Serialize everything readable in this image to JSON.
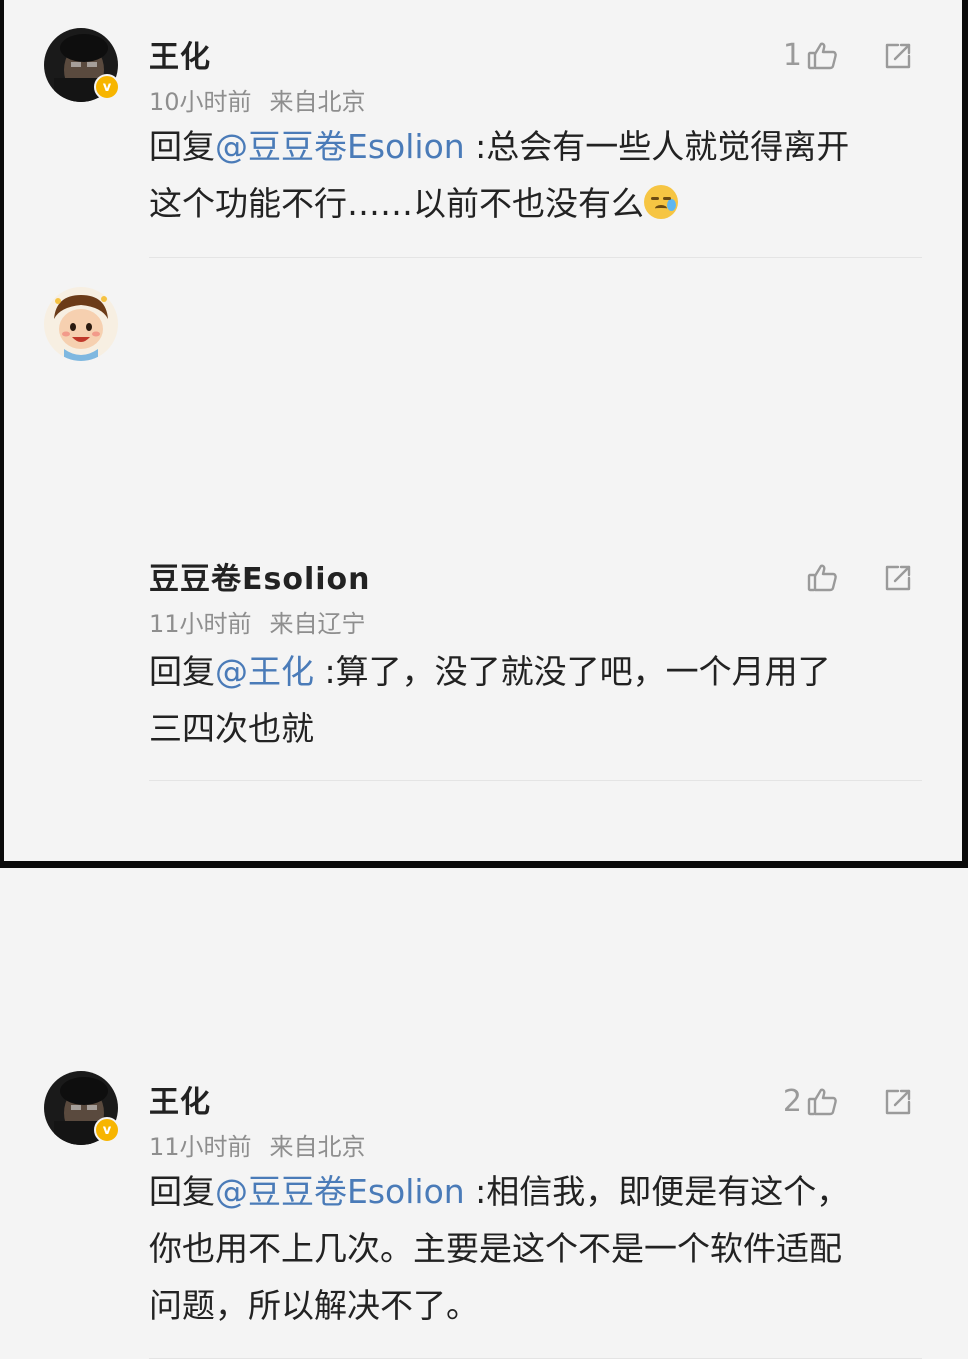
{
  "comments": [
    {
      "username": "王化",
      "time": "10小时前",
      "location": "来自北京",
      "like_count": "1",
      "verified": true,
      "reply_prefix": "回复",
      "mention": "@豆豆卷Esolion",
      "text_line1": " :总会有一些人就觉得离开",
      "text_line2": "这个功能不行……以前不也没有么",
      "emoji": "cold-sweat-emoji"
    },
    {
      "username": "豆豆卷Esolion",
      "time": "11小时前",
      "location": "来自辽宁",
      "like_count": "",
      "verified": false,
      "reply_prefix": "回复",
      "mention": "@王化",
      "text_line1": " :算了，没了就没了吧，一个月用了",
      "text_line2": "三四次也就"
    },
    {
      "username": "王化",
      "time": "11小时前",
      "location": "来自北京",
      "like_count": "2",
      "verified": true,
      "reply_prefix": "回复",
      "mention": "@豆豆卷Esolion",
      "text_line1": " :相信我，即便是有这个，",
      "text_line2": "你也用不上几次。主要是这个不是一个软件适配",
      "text_line3": "问题，所以解决不了。"
    }
  ],
  "icons": {
    "like": "thumbs-up-icon",
    "share": "share-icon",
    "verified": "verified-badge-icon"
  },
  "colors": {
    "background": "#f4f4f4",
    "mention": "#4a7bb8",
    "meta": "#8e8e8e",
    "badge": "#f7b500"
  }
}
